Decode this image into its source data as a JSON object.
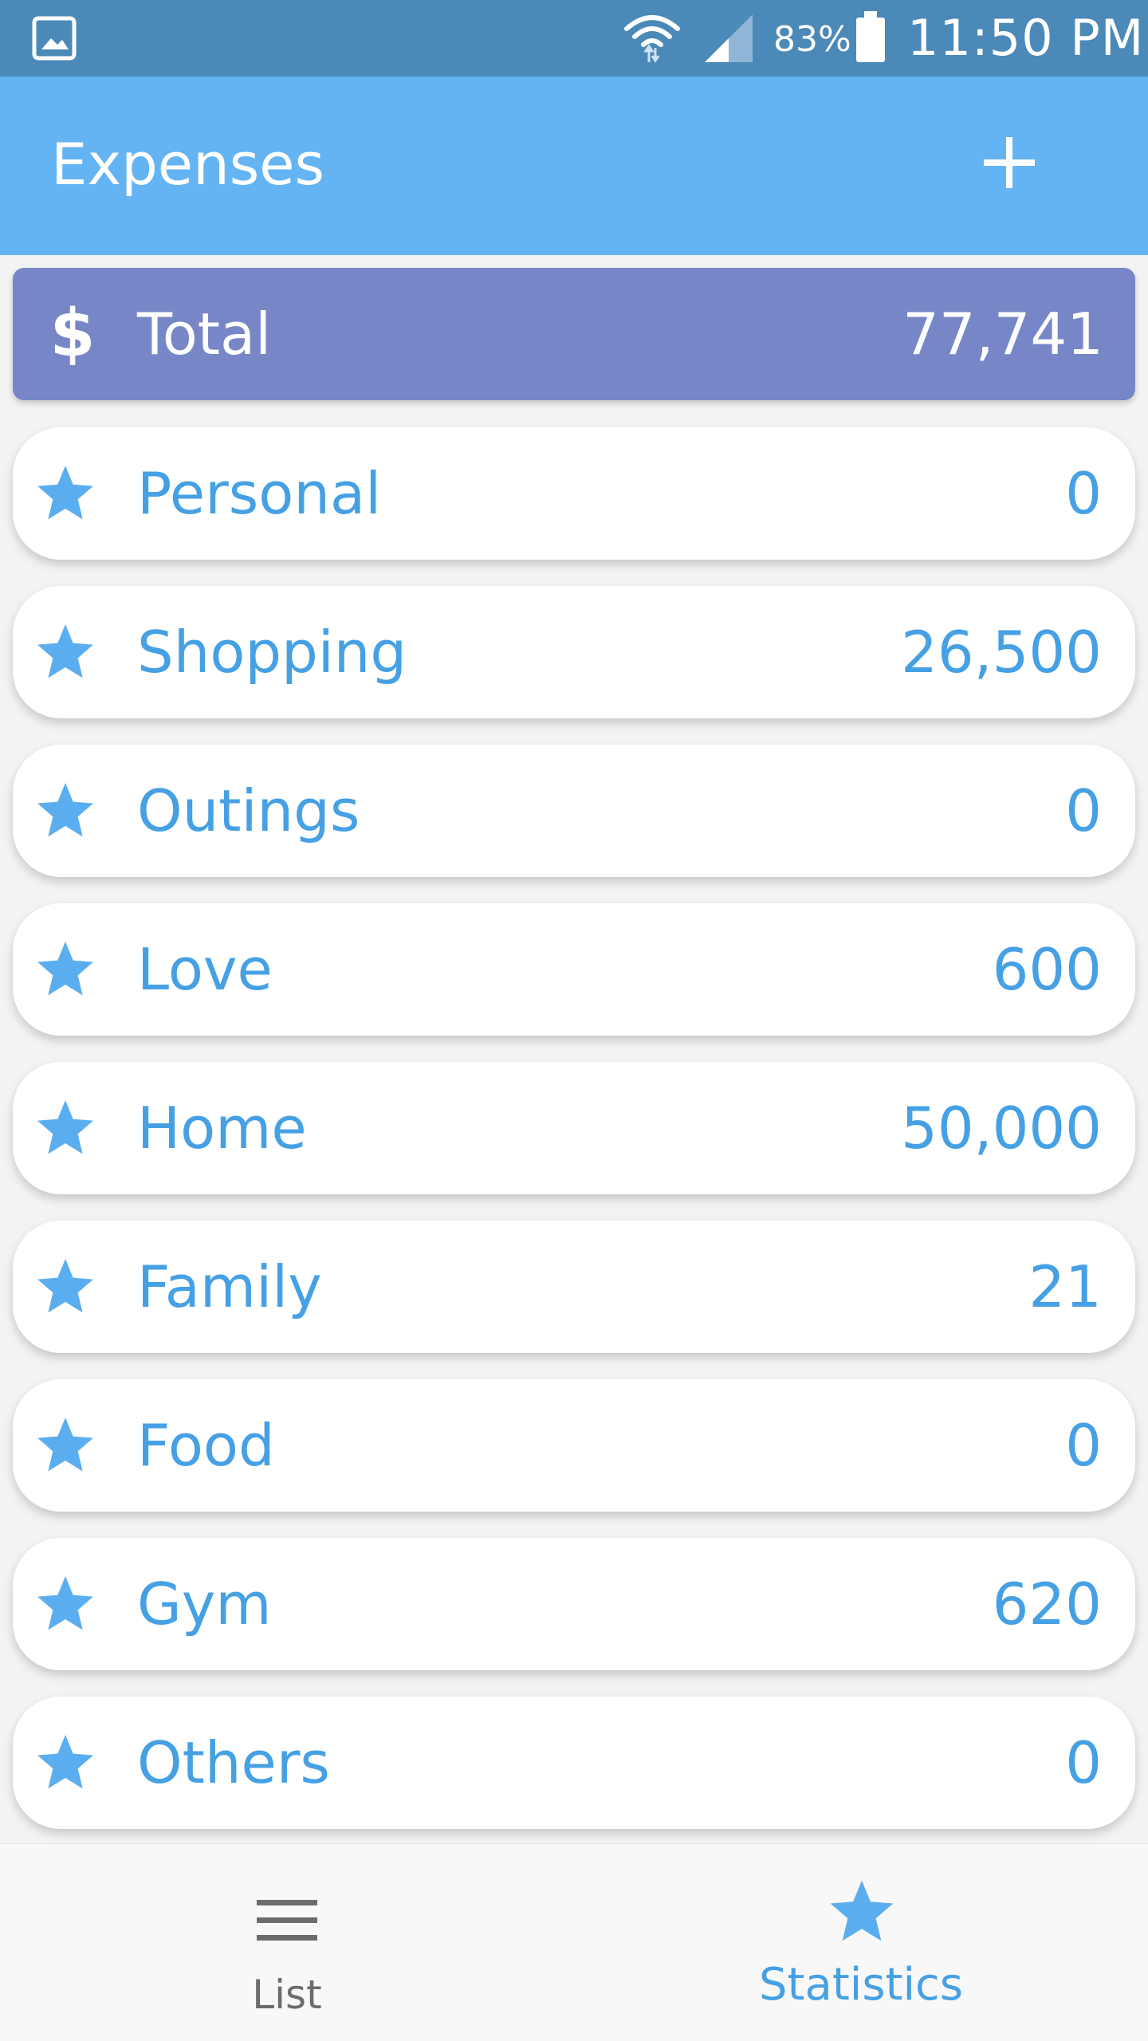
{
  "status_bar": {
    "battery_percent": "83%",
    "time": "11:50 PM",
    "icons": [
      "gallery-icon",
      "wifi-icon",
      "signal-icon",
      "battery-icon"
    ]
  },
  "app_bar": {
    "title": "Expenses",
    "add_icon": "plus-icon"
  },
  "colors": {
    "status_bar": "#4a89b8",
    "app_bar": "#64b4f4",
    "total_card": "#7786c7",
    "accent": "#46a0e4"
  },
  "total": {
    "icon": "dollar-icon",
    "symbol": "$",
    "label": "Total",
    "value": "77,741"
  },
  "categories": [
    {
      "label": "Personal",
      "value": "0",
      "icon": "star-icon"
    },
    {
      "label": "Shopping",
      "value": "26,500",
      "icon": "star-icon"
    },
    {
      "label": "Outings",
      "value": "0",
      "icon": "star-icon"
    },
    {
      "label": "Love",
      "value": "600",
      "icon": "star-icon"
    },
    {
      "label": "Home",
      "value": "50,000",
      "icon": "star-icon"
    },
    {
      "label": "Family",
      "value": "21",
      "icon": "star-icon"
    },
    {
      "label": "Food",
      "value": "0",
      "icon": "star-icon"
    },
    {
      "label": "Gym",
      "value": "620",
      "icon": "star-icon"
    },
    {
      "label": "Others",
      "value": "0",
      "icon": "star-icon"
    }
  ],
  "bottom_nav": {
    "list_label": "List",
    "list_icon": "menu-icon",
    "stats_label": "Statistics",
    "stats_icon": "star-icon",
    "active": "Statistics"
  }
}
